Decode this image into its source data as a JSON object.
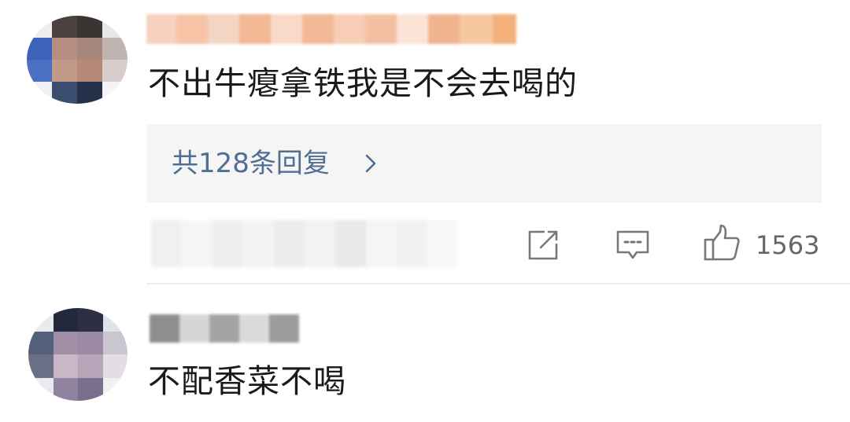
{
  "comments": [
    {
      "text": "不出牛瘪拿铁我是不会去喝的",
      "replies_label": "共128条回复",
      "like_count": "1563"
    },
    {
      "text": "不配香菜不喝"
    }
  ],
  "icons": {
    "share": "share-icon",
    "reply": "comment-icon",
    "like": "thumbs-up-icon",
    "chevron": "chevron-right-icon"
  },
  "colors": {
    "reply_link": "#4f6e94",
    "reply_box_bg": "#f5f5f5",
    "icon_gray": "#777777"
  }
}
